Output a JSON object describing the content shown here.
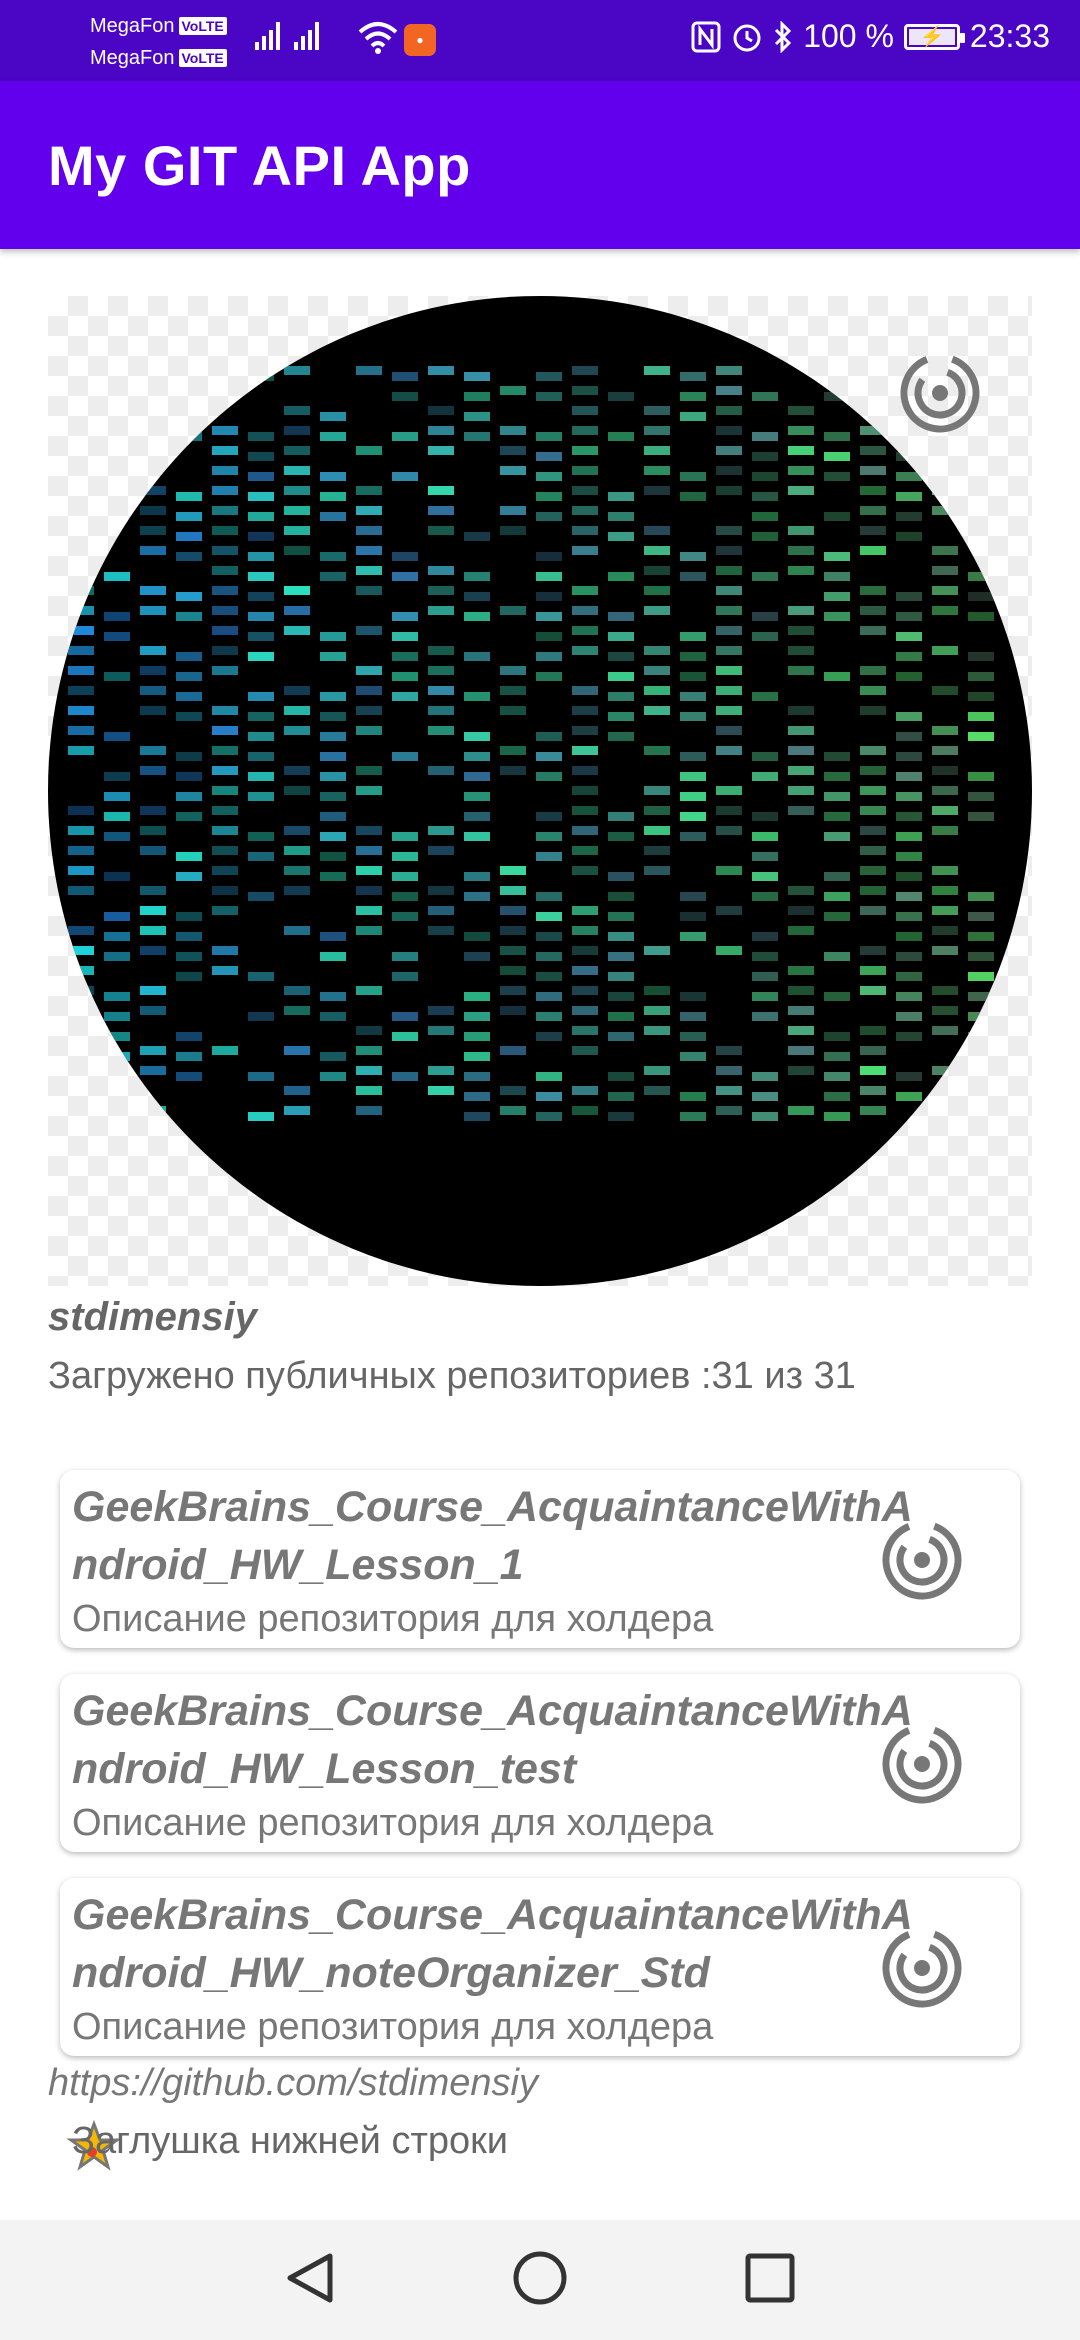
{
  "status_bar": {
    "carrier_1": "MegaFon",
    "carrier_2": "MegaFon",
    "volte": "VoLTE",
    "battery": "100 %",
    "time": "23:33",
    "icons": [
      "signal-icon",
      "wifi-icon",
      "nfc-icon",
      "alarm-icon",
      "bluetooth-icon",
      "battery-icon"
    ]
  },
  "app_bar": {
    "title": "My GIT API App"
  },
  "profile": {
    "username": "stdimensiy",
    "repo_count_text": "Загружено публичных репозиториев :31 из 31",
    "url": "https://github.com/stdimensiy",
    "footer_text": "Заглушка нижней строки"
  },
  "repos": [
    {
      "name": "GeekBrains_Course_AcquaintanceWithAndroid_HW_Lesson_1",
      "description": "Описание репозитория для холдера"
    },
    {
      "name": "GeekBrains_Course_AcquaintanceWithAndroid_HW_Lesson_test",
      "description": "Описание репозитория для холдера"
    },
    {
      "name": "GeekBrains_Course_AcquaintanceWithAndroid_HW_noteOrganizer_Std",
      "description": "Описание репозитория для холдера"
    }
  ],
  "colors": {
    "status_bar": "#4a06c4",
    "app_bar": "#6200ee",
    "text_gray": "#777777"
  }
}
